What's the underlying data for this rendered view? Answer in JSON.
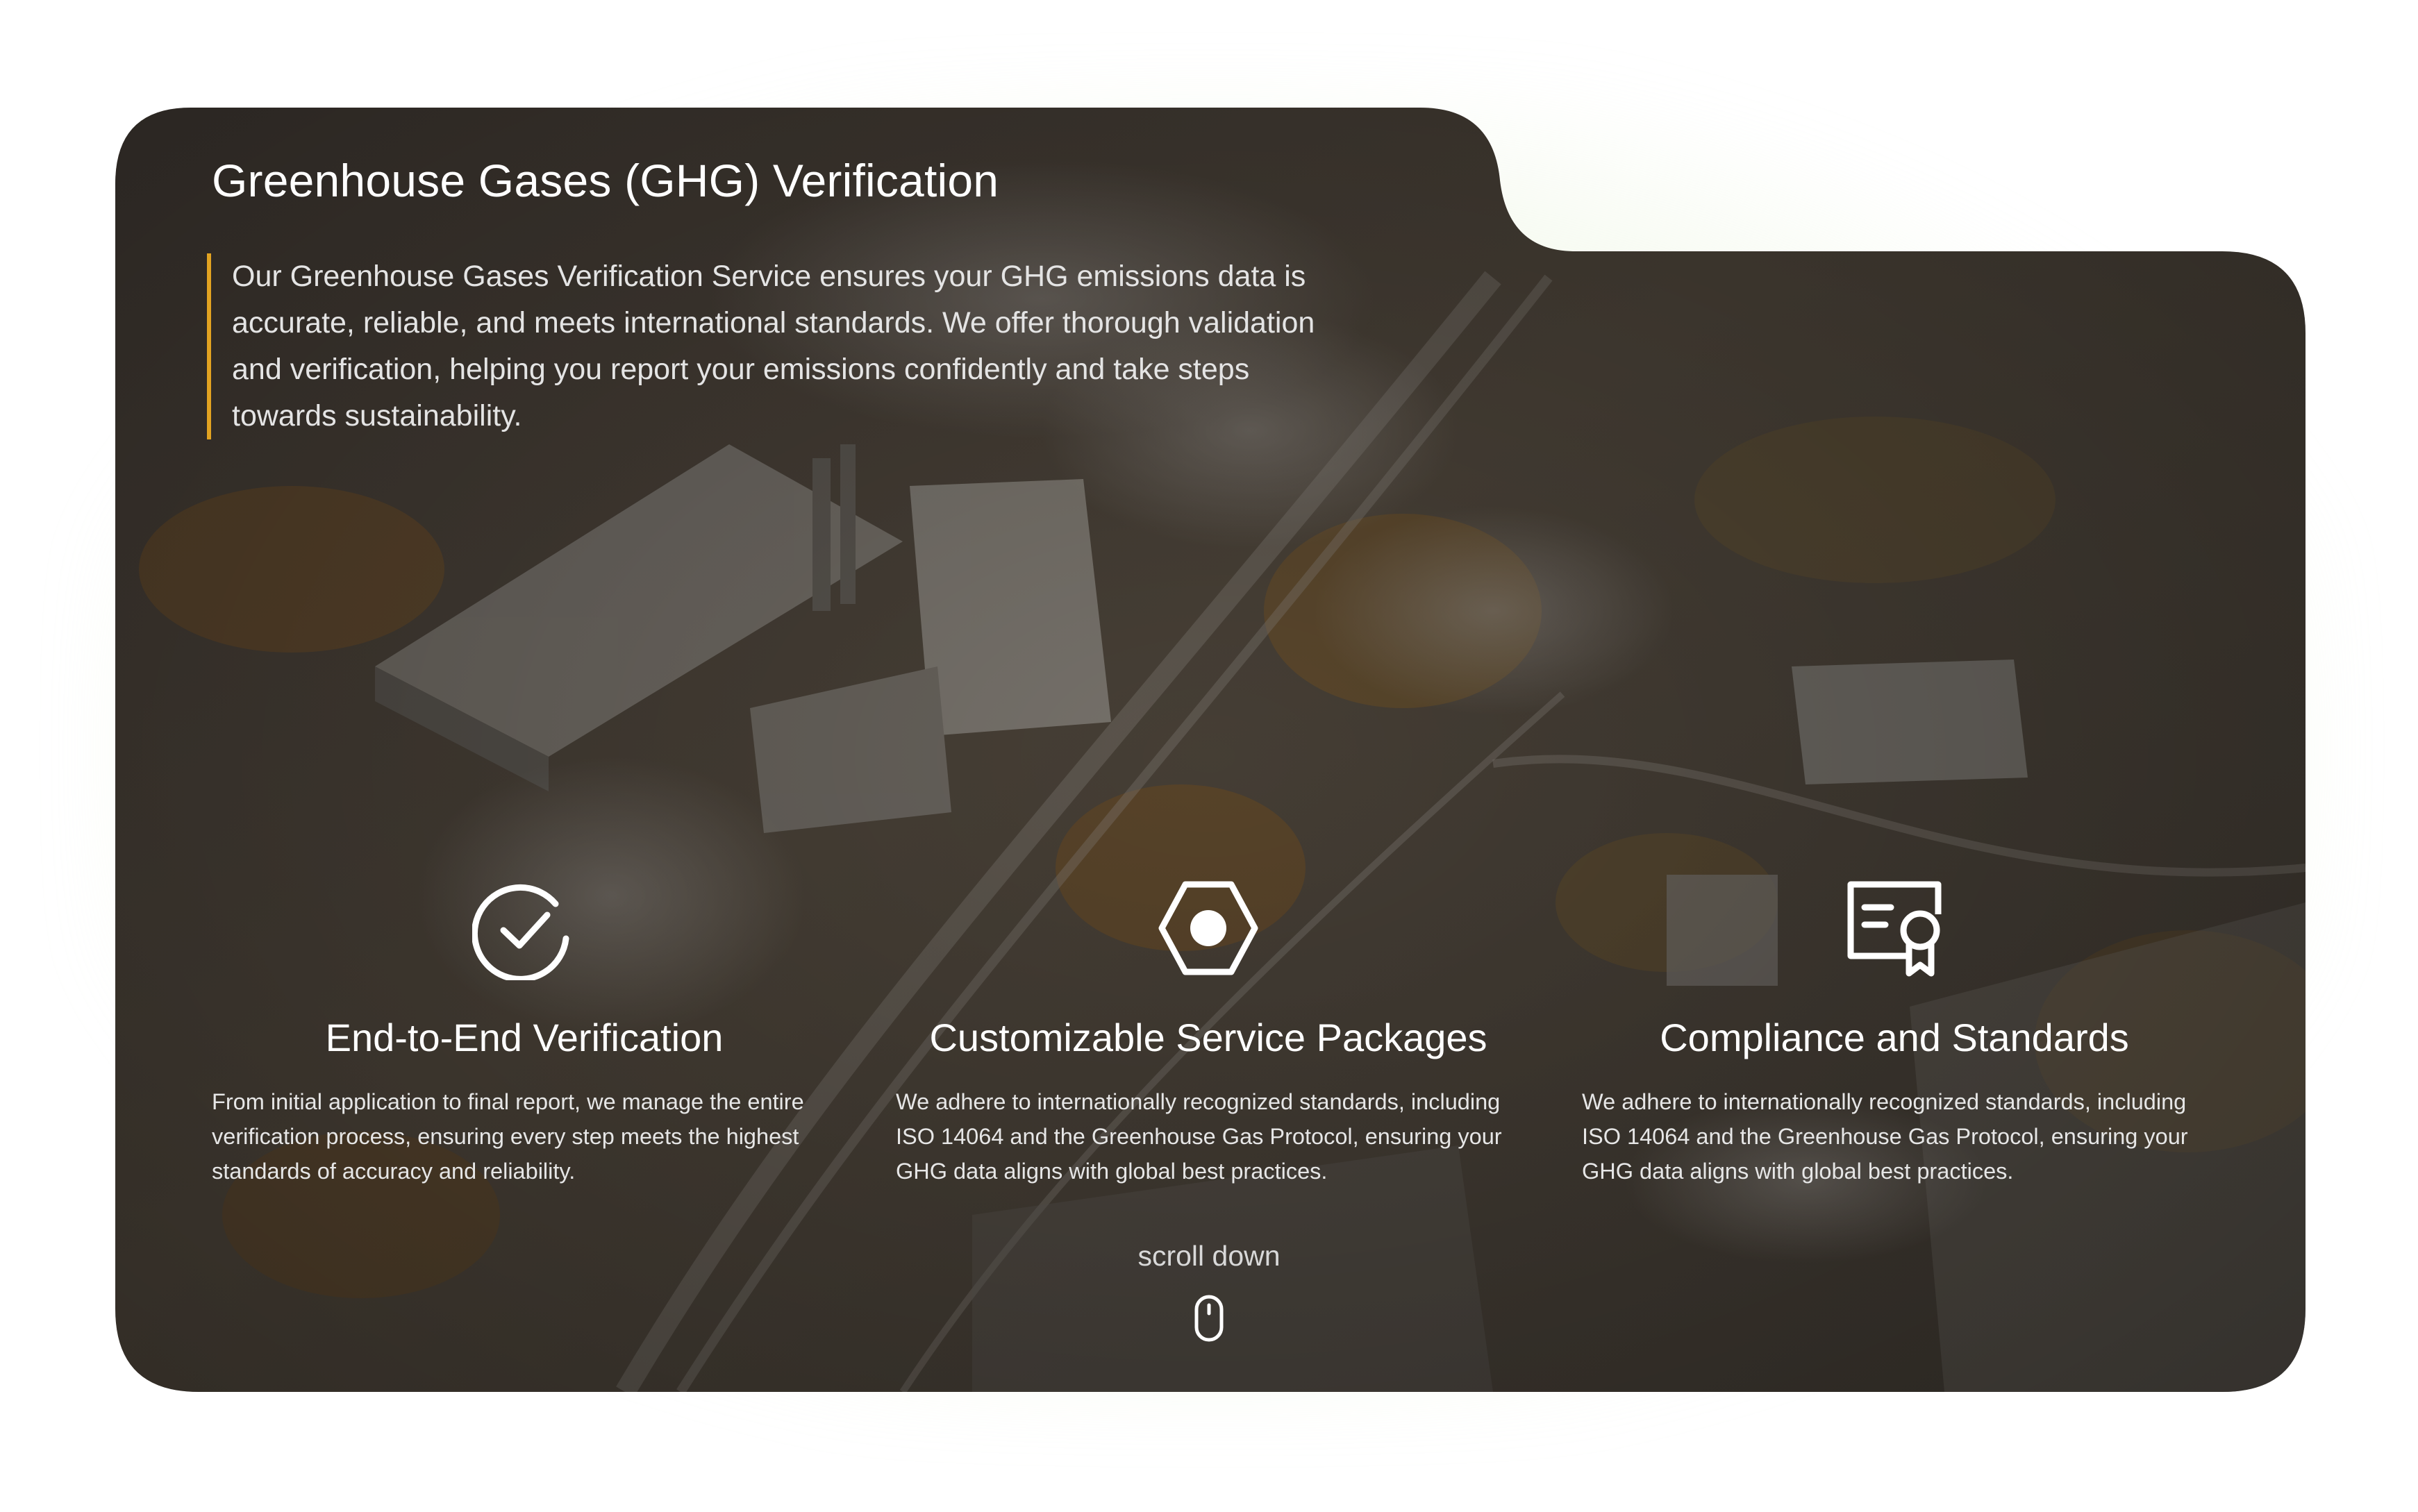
{
  "section": {
    "title": "Greenhouse Gases (GHG) Verification",
    "intro_lines": [
      "Our Greenhouse Gases Verification Service ensures your GHG emissions data is",
      "accurate, reliable, and meets international standards. We offer thorough validation",
      "and verification, helping you report your emissions confidently and take steps",
      "towards sustainability."
    ]
  },
  "features": [
    {
      "icon": "check-circle-icon",
      "title": "End-to-End Verification",
      "description": "From initial application to final report, we manage the entire verification process, ensuring every step meets the highest standards of accuracy and reliability."
    },
    {
      "icon": "hexagon-dot-icon",
      "title": "Customizable Service Packages",
      "description": "We adhere to internationally recognized standards, including ISO 14064 and the Greenhouse Gas Protocol, ensuring your GHG data aligns with global best practices."
    },
    {
      "icon": "certificate-icon",
      "title": "Compliance and Standards",
      "description": "We adhere to internationally recognized standards, including ISO 14064 and the Greenhouse Gas Protocol, ensuring your GHG data aligns with global best practices."
    }
  ],
  "scroll": {
    "label": "scroll down",
    "icon": "mouse-icon"
  },
  "colors": {
    "accent_bar": "#e2a321",
    "card_overlay": "#3b3630",
    "text_primary": "#ffffff"
  }
}
